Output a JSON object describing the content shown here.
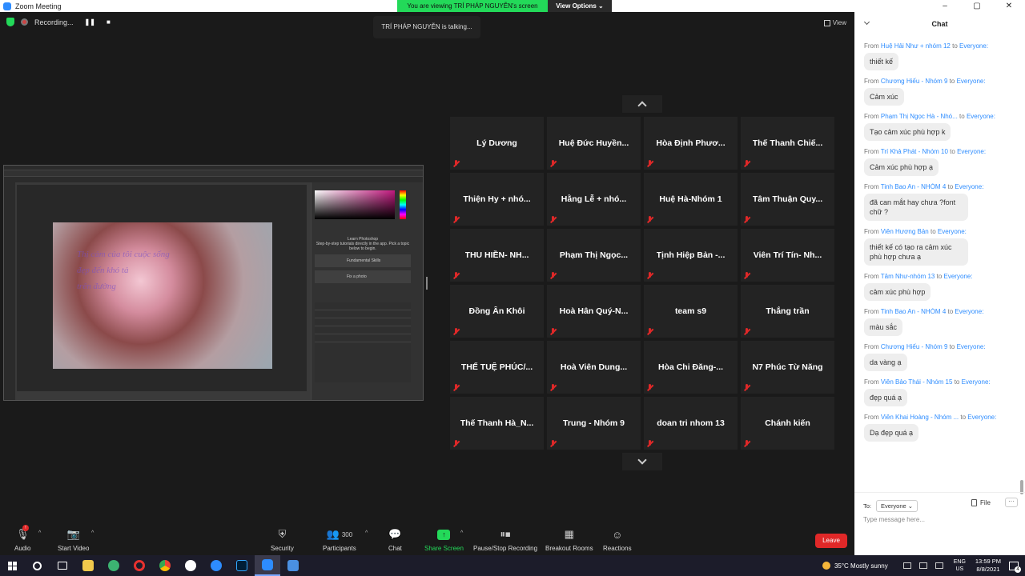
{
  "window": {
    "title": "Zoom Meeting",
    "controls": [
      "–",
      "▢",
      "✕"
    ]
  },
  "share_banner": {
    "text": "You are viewing TRÍ PHÁP NGUYỄN's screen",
    "options_label": "View Options ⌄"
  },
  "recording": {
    "label": "Recording...",
    "pause": "❚❚",
    "stop": "■"
  },
  "talking": "TRÍ PHÁP NGUYỄN is talking...",
  "view_label": "View",
  "shared_screen": {
    "overlay_lines": [
      "Thị cảm của tôi cuộc sống",
      "đẹp đến khó tả",
      "trên đường"
    ],
    "learn_title": "Learn Photoshop",
    "learn_desc": "Step-by-step tutorials directly in the app. Pick a topic below to begin.",
    "tutorials": [
      "Fundamental Skills",
      "Fix a photo"
    ]
  },
  "participants": [
    "Lý Dương",
    "Huệ Đức Huyền...",
    "Hòa Định Phươ...",
    "Thế Thanh Chiế...",
    "Thiện Hy + nhó...",
    "Hằng Lễ + nhó...",
    "Huệ Hà-Nhóm 1",
    "Tâm Thuận Quy...",
    "THU HIỀN- NH...",
    "Phạm Thị Ngọc...",
    "Tịnh Hiệp Bản -...",
    "Viên Trí Tín- Nh...",
    "Đồng Ân Khôi",
    "Hoà Hân Quý-N...",
    "team s9",
    "Thắng trần",
    "THẾ TUỆ PHÚC/...",
    "Hoà Viên Dung...",
    "Hòa Chi Đăng-...",
    "N7 Phúc Từ Năng",
    "Thế Thanh Hà_N...",
    "Trung - Nhóm 9",
    "doan tri nhom 13",
    "Chánh kiến"
  ],
  "toolbar": {
    "audio": "Audio",
    "video": "Start Video",
    "security": "Security",
    "participants": "Participants",
    "participants_count": "300",
    "chat": "Chat",
    "share": "Share Screen",
    "record": "Pause/Stop Recording",
    "breakout": "Breakout Rooms",
    "reactions": "Reactions",
    "leave": "Leave"
  },
  "chat": {
    "header": "Chat",
    "from_word": "From",
    "to_word": "to",
    "messages": [
      {
        "sender": "Huệ Hải Như + nhóm 12",
        "to": "Everyone:",
        "text": "thiết kế"
      },
      {
        "sender": "Chương Hiếu - Nhóm 9",
        "to": "Everyone:",
        "text": "Cảm xúc"
      },
      {
        "sender": "Phạm Thị Ngọc Hà - Nhó...",
        "to": "Everyone:",
        "text": "Tạo cảm xúc phù hợp k"
      },
      {
        "sender": "Trí Khả Phát - Nhóm 10",
        "to": "Everyone:",
        "text": "Cảm xúc phù hợp ạ"
      },
      {
        "sender": "Tinh Bao An - NHÓM 4",
        "to": "Everyone:",
        "text": "đã can mắt hay chưa ?font chữ ?"
      },
      {
        "sender": "Viên Hương Bản",
        "to": "Everyone:",
        "text": "thiết kế có tạo ra cảm xúc phù hợp chưa ạ"
      },
      {
        "sender": "Tâm Như-nhóm 13",
        "to": "Everyone:",
        "text": "cảm xúc phù hợp"
      },
      {
        "sender": "Tinh Bao An - NHÓM 4",
        "to": "Everyone:",
        "text": "màu sắc"
      },
      {
        "sender": "Chương Hiếu - Nhóm 9",
        "to": "Everyone:",
        "text": "da vàng ạ"
      },
      {
        "sender": "Viên Bảo Thái - Nhóm 15",
        "to": "Everyone:",
        "text": "đẹp quá ạ"
      },
      {
        "sender": "Viên Khai Hoàng - Nhóm ...",
        "to": "Everyone:",
        "text": "Dạ đẹp quá ạ"
      }
    ],
    "to_label": "To:",
    "to_value": "Everyone ⌄",
    "file_label": "File",
    "more": "···",
    "input_placeholder": "Type message here..."
  },
  "taskbar": {
    "weather": "35°C  Mostly sunny",
    "lang_top": "ENG",
    "lang_bottom": "US",
    "time": "13:59 PM",
    "date": "8/8/2021",
    "notifications": "4"
  }
}
